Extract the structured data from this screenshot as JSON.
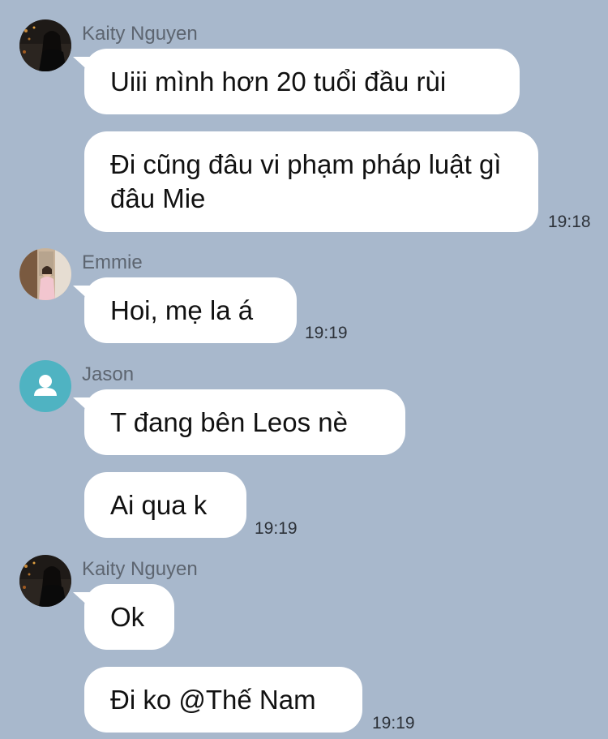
{
  "messages": [
    {
      "sender": "Kaity Nguyen",
      "avatar": "kaity-avatar",
      "bubbles": [
        "Uiii mình hơn 20 tuổi đầu rùi",
        "Đi cũng đâu vi phạm pháp luật gì đâu Mie"
      ],
      "time": "19:18"
    },
    {
      "sender": "Emmie",
      "avatar": "emmie-avatar",
      "bubbles": [
        "Hoi, mẹ la á"
      ],
      "time": "19:19"
    },
    {
      "sender": "Jason",
      "avatar": "default-user-avatar",
      "bubbles": [
        "T đang bên Leos nè",
        "Ai qua k"
      ],
      "time": "19:19"
    },
    {
      "sender": "Kaity Nguyen",
      "avatar": "kaity-avatar",
      "bubbles": [
        "Ok",
        "Đi ko @Thế Nam"
      ],
      "time": "19:19"
    }
  ],
  "colors": {
    "background": "#a8b8cc",
    "bubble": "#ffffff",
    "jason_avatar": "#4fb3c2"
  }
}
